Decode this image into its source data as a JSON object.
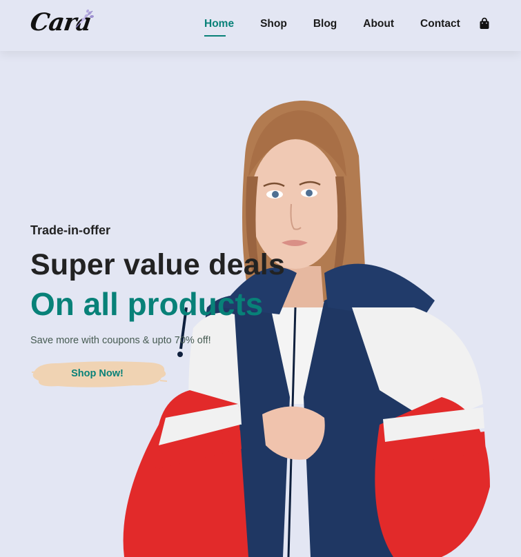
{
  "brand": {
    "name": "Cara"
  },
  "nav": {
    "items": [
      {
        "label": "Home",
        "active": true
      },
      {
        "label": "Shop",
        "active": false
      },
      {
        "label": "Blog",
        "active": false
      },
      {
        "label": "About",
        "active": false
      },
      {
        "label": "Contact",
        "active": false
      }
    ],
    "cart_icon": "shopping-bag-icon"
  },
  "hero": {
    "kicker": "Trade-in-offer",
    "headline": "Super value deals",
    "subheadline": "On all products",
    "blurb": "Save more with coupons & upto 70% off!",
    "cta_label": "Shop Now!",
    "image": "woman-in-red-white-navy-windbreaker"
  },
  "colors": {
    "background": "#e3e6f3",
    "accent": "#088178",
    "button_brush": "#f0d3b3",
    "text_dark": "#222222"
  }
}
